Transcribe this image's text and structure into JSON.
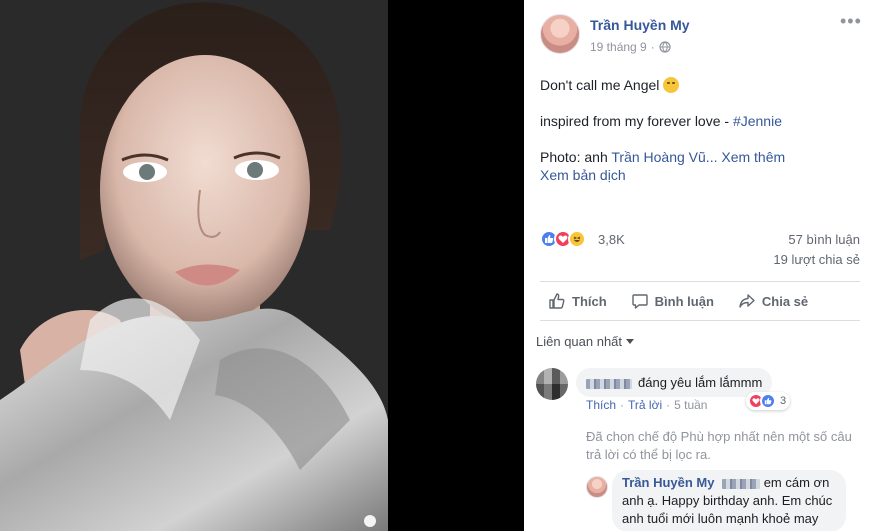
{
  "post": {
    "author": "Trần Huyền My",
    "date": "19 tháng 9",
    "dot": "·",
    "line1": "Don't call me Angel",
    "line2_prefix": "inspired from my forever love - ",
    "hashtag": "#Jennie",
    "photo_credit_prefix": "Photo: anh ",
    "photo_credit_name": "Trần Hoàng Vũ...",
    "see_more": "Xem thêm",
    "see_translation": "Xem bản dịch",
    "reaction_count": "3,8K",
    "comment_count": "57 bình luận",
    "share_count": "19 lượt chia sẻ"
  },
  "actions": {
    "like": "Thích",
    "comment": "Bình luận",
    "share": "Chia sẻ"
  },
  "comments_sort": "Liên quan nhất",
  "comments": [
    {
      "text": "đáng yêu lắm lắmmm",
      "like": "Thích",
      "sep": "·",
      "reply": "Trả lời",
      "time": "5 tuần",
      "reaction_count": "3"
    }
  ],
  "filter_note": "Đã chọn chế độ Phù hợp nhất nên một số câu trả lời có thể bị lọc ra.",
  "reply": {
    "author": "Trần Huyền My",
    "text": " em cám ơn anh ạ. Happy birthday anh. Em chúc anh tuổi mới luôn mạnh khoẻ may"
  },
  "colors": {
    "link": "#365899",
    "like": "#4c7ff0",
    "love": "#f0405e",
    "haha": "#f7c53a"
  }
}
